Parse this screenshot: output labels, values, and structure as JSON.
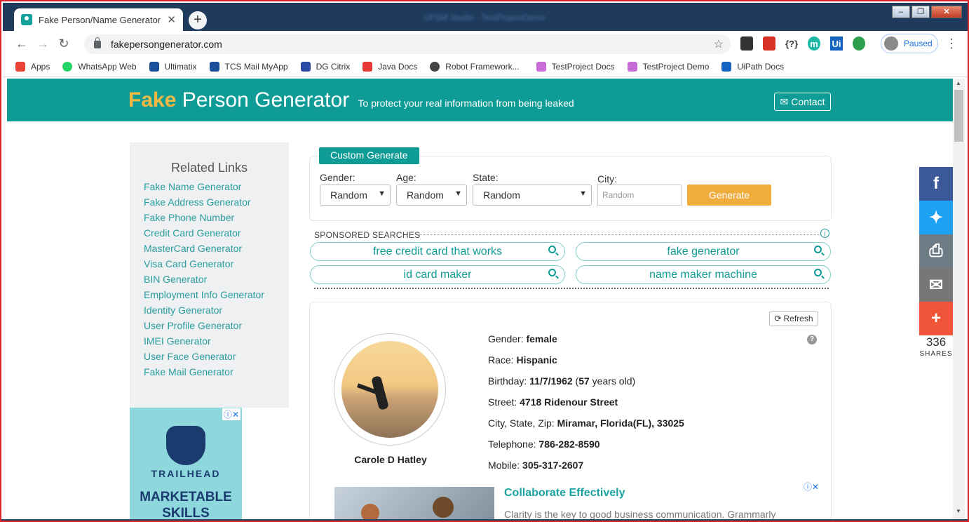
{
  "browser": {
    "tab_title": "Fake Person/Name Generator | U",
    "tab_close": "✕",
    "new_tab": "+",
    "window_title": "UPSM Studio - TestProjectDemo",
    "url": "fakepersongenerator.com",
    "profile_status": "Paused",
    "extensions": [
      "{?}",
      "m",
      "Ui"
    ]
  },
  "bookmarks": [
    {
      "label": "Apps",
      "color": "#ea4335"
    },
    {
      "label": "WhatsApp Web",
      "color": "#25d366"
    },
    {
      "label": "Ultimatix",
      "color": "#1a4f9c"
    },
    {
      "label": "TCS Mail MyApp",
      "color": "#1a4f9c"
    },
    {
      "label": "DG Citrix",
      "color": "#2b4aa3"
    },
    {
      "label": "Java Docs",
      "color": "#e53935"
    },
    {
      "label": "Robot Framework...",
      "color": "#444444"
    },
    {
      "label": "TestProject Docs",
      "color": "#c86dd7"
    },
    {
      "label": "TestProject Demo",
      "color": "#c86dd7"
    },
    {
      "label": "UiPath Docs",
      "color": "#1565c0"
    }
  ],
  "header": {
    "brand_fake": "Fake",
    "brand_rest": "Person Generator",
    "tagline": "To protect your real information from being leaked",
    "contact": "Contact"
  },
  "sidebar": {
    "title": "Related Links",
    "links": [
      "Fake Name Generator",
      "Fake Address Generator",
      "Fake Phone Number",
      "Credit Card Generator",
      "MasterCard Generator",
      "Visa Card Generator",
      "BIN Generator",
      "Employment Info Generator",
      "Identity Generator",
      "User Profile Generator",
      "IMEI Generator",
      "User Face Generator",
      "Fake Mail Generator"
    ]
  },
  "side_ad": {
    "brand": "TRAILHEAD",
    "headline": "MARKETABLE SKILLS"
  },
  "form": {
    "tab": "Custom Generate",
    "gender_label": "Gender:",
    "gender_value": "Random",
    "age_label": "Age:",
    "age_value": "Random",
    "state_label": "State:",
    "state_value": "Random",
    "city_label": "City:",
    "city_placeholder": "Random",
    "generate": "Generate"
  },
  "sponsored": {
    "title": "SPONSORED SEARCHES",
    "items": [
      "free credit card that works",
      "fake generator",
      "id card maker",
      "name maker machine"
    ]
  },
  "person": {
    "refresh": "Refresh",
    "name": "Carole D Hatley",
    "gender_label": "Gender:",
    "gender": "female",
    "race_label": "Race:",
    "race": "Hispanic",
    "birthday_label": "Birthday:",
    "birthday": "11/7/1962",
    "age_open": " (",
    "age": "57",
    "age_suffix": " years old)",
    "street_label": "Street:",
    "street": "4718 Ridenour Street",
    "csz_label": "City, State, Zip:",
    "csz": "Miramar, Florida(FL), 33025",
    "tel_label": "Telephone:",
    "tel": "786-282-8590",
    "mobile_label": "Mobile:",
    "mobile": "305-317-2607"
  },
  "content_ad": {
    "title": "Collaborate Effectively",
    "text": "Clarity is the key to good business communication. Grammarly"
  },
  "share": {
    "count": "336",
    "label": "SHARES",
    "colors": [
      "#3b5998",
      "#1da1f2",
      "#6e7c86",
      "#777777",
      "#f0553a"
    ]
  }
}
